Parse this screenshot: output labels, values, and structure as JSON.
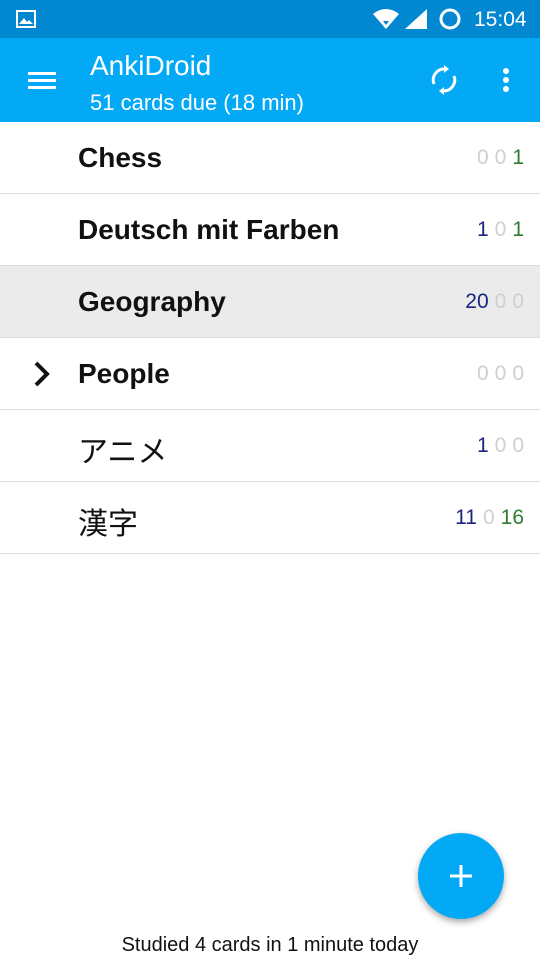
{
  "status_bar": {
    "time": "15:04",
    "icons": [
      "gallery-icon",
      "wifi-icon",
      "signal-icon",
      "sync-status-icon"
    ]
  },
  "app_bar": {
    "title": "AnkiDroid",
    "subtitle": "51 cards due (18 min)",
    "color": "#03a9f4",
    "icons": [
      "menu-icon",
      "sync-icon",
      "more-vertical-icon"
    ]
  },
  "decks": [
    {
      "name": "Chess",
      "new": "0",
      "learn": "0",
      "review": "1",
      "selected": false,
      "collapsed_children": false
    },
    {
      "name": "Deutsch mit Farben",
      "new": "1",
      "learn": "0",
      "review": "1",
      "selected": false,
      "collapsed_children": false
    },
    {
      "name": "Geography",
      "new": "20",
      "learn": "0",
      "review": "0",
      "selected": true,
      "collapsed_children": false
    },
    {
      "name": "People",
      "new": "0",
      "learn": "0",
      "review": "0",
      "selected": false,
      "collapsed_children": true
    },
    {
      "name": "アニメ",
      "new": "1",
      "learn": "0",
      "review": "0",
      "selected": false,
      "collapsed_children": false
    },
    {
      "name": "漢字",
      "new": "11",
      "learn": "0",
      "review": "16",
      "selected": false,
      "collapsed_children": false
    }
  ],
  "count_colors": {
    "new": "#1a237e",
    "learn": "#c62828",
    "review": "#2e7d32",
    "zero": "#cfcfcf"
  },
  "fab": {
    "icon": "plus-icon"
  },
  "footer": {
    "studied_text": "Studied 4 cards in 1 minute today"
  }
}
